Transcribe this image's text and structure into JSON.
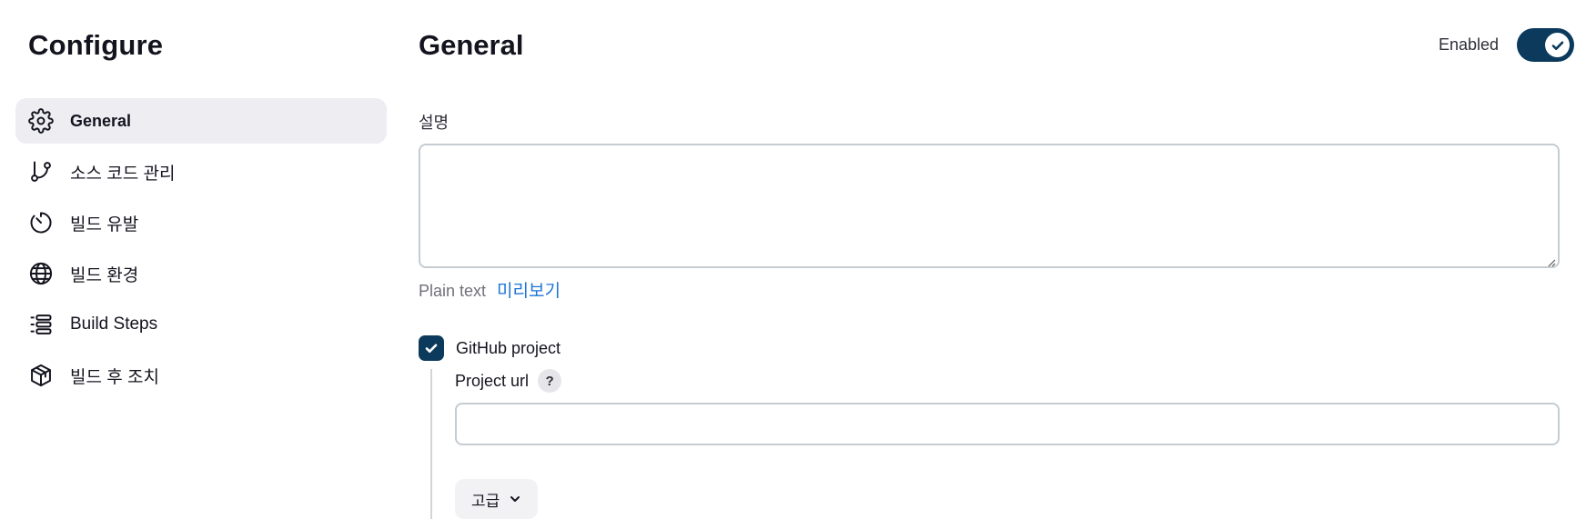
{
  "sidebar": {
    "title": "Configure",
    "items": [
      {
        "label": "General",
        "icon": "gear-icon",
        "active": true
      },
      {
        "label": "소스 코드 관리",
        "icon": "git-branch-icon",
        "active": false
      },
      {
        "label": "빌드 유발",
        "icon": "timer-icon",
        "active": false
      },
      {
        "label": "빌드 환경",
        "icon": "globe-icon",
        "active": false
      },
      {
        "label": "Build Steps",
        "icon": "list-icon",
        "active": false
      },
      {
        "label": "빌드 후 조치",
        "icon": "package-icon",
        "active": false
      }
    ]
  },
  "main": {
    "title": "General",
    "enabled": {
      "label": "Enabled",
      "state": true
    },
    "description": {
      "label": "설명",
      "value": "",
      "format_label": "Plain text",
      "preview_link": "미리보기"
    },
    "github_project": {
      "label": "GitHub project",
      "checked": true,
      "project_url": {
        "label": "Project url",
        "help": "?",
        "value": ""
      },
      "advanced_button": "고급"
    }
  },
  "colors": {
    "accent": "#0b3a5c",
    "link": "#1e74d6",
    "active_nav_bg": "#ededf2"
  }
}
